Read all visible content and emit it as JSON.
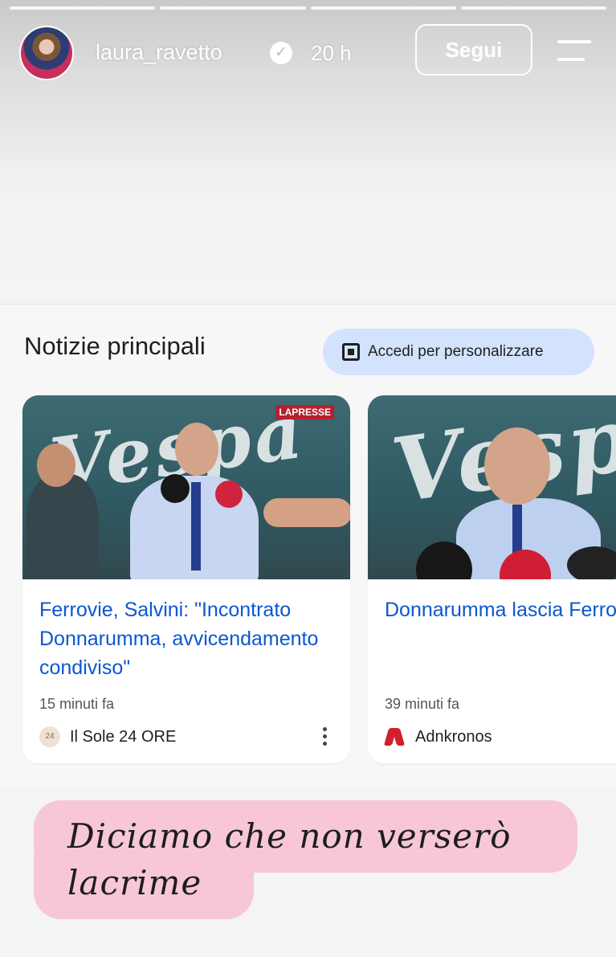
{
  "story": {
    "username": "laura_ravetto",
    "time_ago": "20 h",
    "follow_label": "Segui",
    "progress_segments": 4
  },
  "news": {
    "section_title": "Notizie principali",
    "signin_label": "Accedi per personalizzare",
    "cards": [
      {
        "headline": "Ferrovie, Salvini: \"Incontrato Donnarumma, avvicendamento condiviso\"",
        "time": "15 minuti fa",
        "source": "Il Sole 24 ORE",
        "source_logo_text": "24",
        "image_logo_text": "Vespa",
        "image_watermark": "LAPRESSE"
      },
      {
        "headline": "Donnarumma lascia Ferrovie, Salvini precis \"Tutto concordato\"",
        "time": "39 minuti fa",
        "source": "Adnkronos",
        "image_logo_text": "Vespa"
      }
    ]
  },
  "caption": {
    "text": "Diciamo che non verserò lacrime",
    "background": "#f7c7d6"
  },
  "icons": [
    "verified-badge-icon",
    "menu-lines-icon",
    "personalize-icon",
    "more-vert-icon",
    "sole24ore-logo-icon",
    "adnkronos-logo-icon"
  ]
}
